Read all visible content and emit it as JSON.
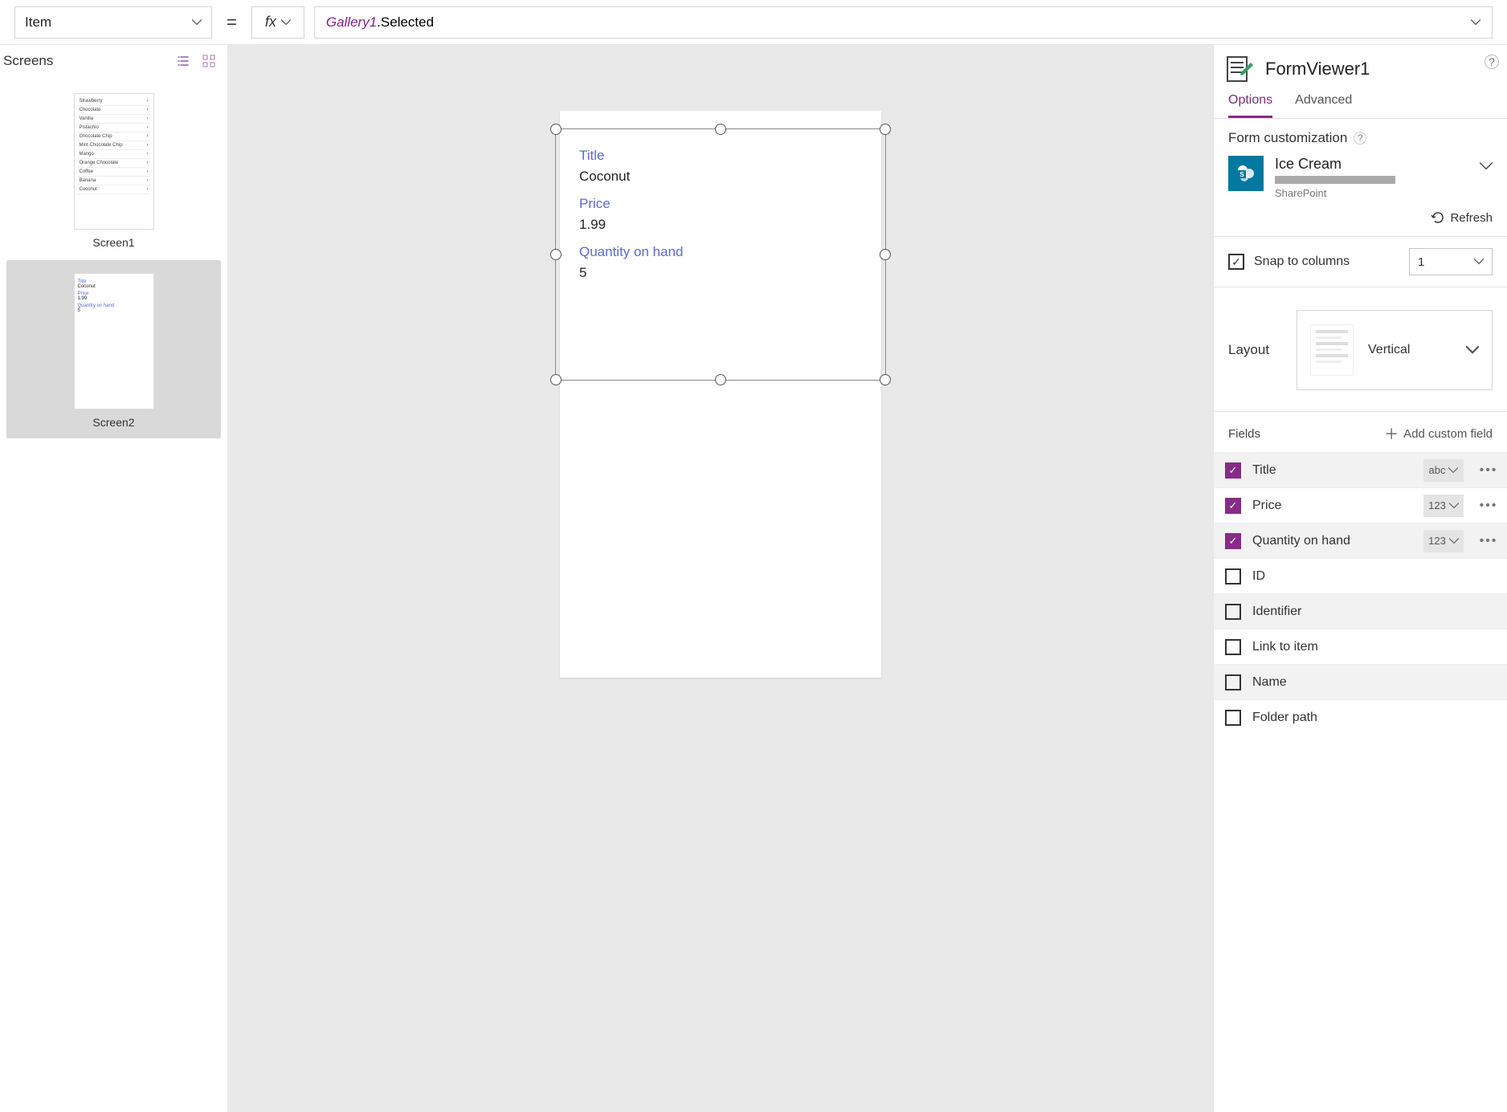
{
  "topbar": {
    "property": "Item",
    "fx_label": "fx",
    "formula_obj": "Gallery1",
    "formula_rest": ".Selected"
  },
  "left": {
    "title": "Screens",
    "screen1": {
      "caption": "Screen1",
      "items": [
        "Strawberry",
        "Chocolate",
        "Vanilla",
        "Pistachio",
        "Chocolate Chip",
        "Mint Chocolate Chip",
        "Mango",
        "Orange Chocolate",
        "Coffee",
        "Banana",
        "Coconut"
      ]
    },
    "screen2": {
      "caption": "Screen2",
      "labels": [
        "Title",
        "Coconut",
        "Price",
        "1.99",
        "Quantity on hand",
        "5"
      ]
    }
  },
  "canvas": {
    "fields": [
      {
        "label": "Title",
        "value": "Coconut"
      },
      {
        "label": "Price",
        "value": "1.99"
      },
      {
        "label": "Quantity on hand",
        "value": "5"
      }
    ]
  },
  "right": {
    "name": "FormViewer1",
    "tabs": {
      "options": "Options",
      "advanced": "Advanced"
    },
    "form_customization": "Form customization",
    "datasource": {
      "name": "Ice Cream",
      "provider": "SharePoint"
    },
    "refresh": "Refresh",
    "snap_label": "Snap to columns",
    "columns_value": "1",
    "layout_label": "Layout",
    "layout_value": "Vertical",
    "fields_label": "Fields",
    "add_field": "Add custom field",
    "type_abc": "abc",
    "type_123": "123",
    "fields": [
      {
        "name": "Title",
        "on": true,
        "type": "abc"
      },
      {
        "name": "Price",
        "on": true,
        "type": "123"
      },
      {
        "name": "Quantity on hand",
        "on": true,
        "type": "123"
      },
      {
        "name": "ID",
        "on": false
      },
      {
        "name": "Identifier",
        "on": false
      },
      {
        "name": "Link to item",
        "on": false
      },
      {
        "name": "Name",
        "on": false
      },
      {
        "name": "Folder path",
        "on": false
      }
    ]
  }
}
